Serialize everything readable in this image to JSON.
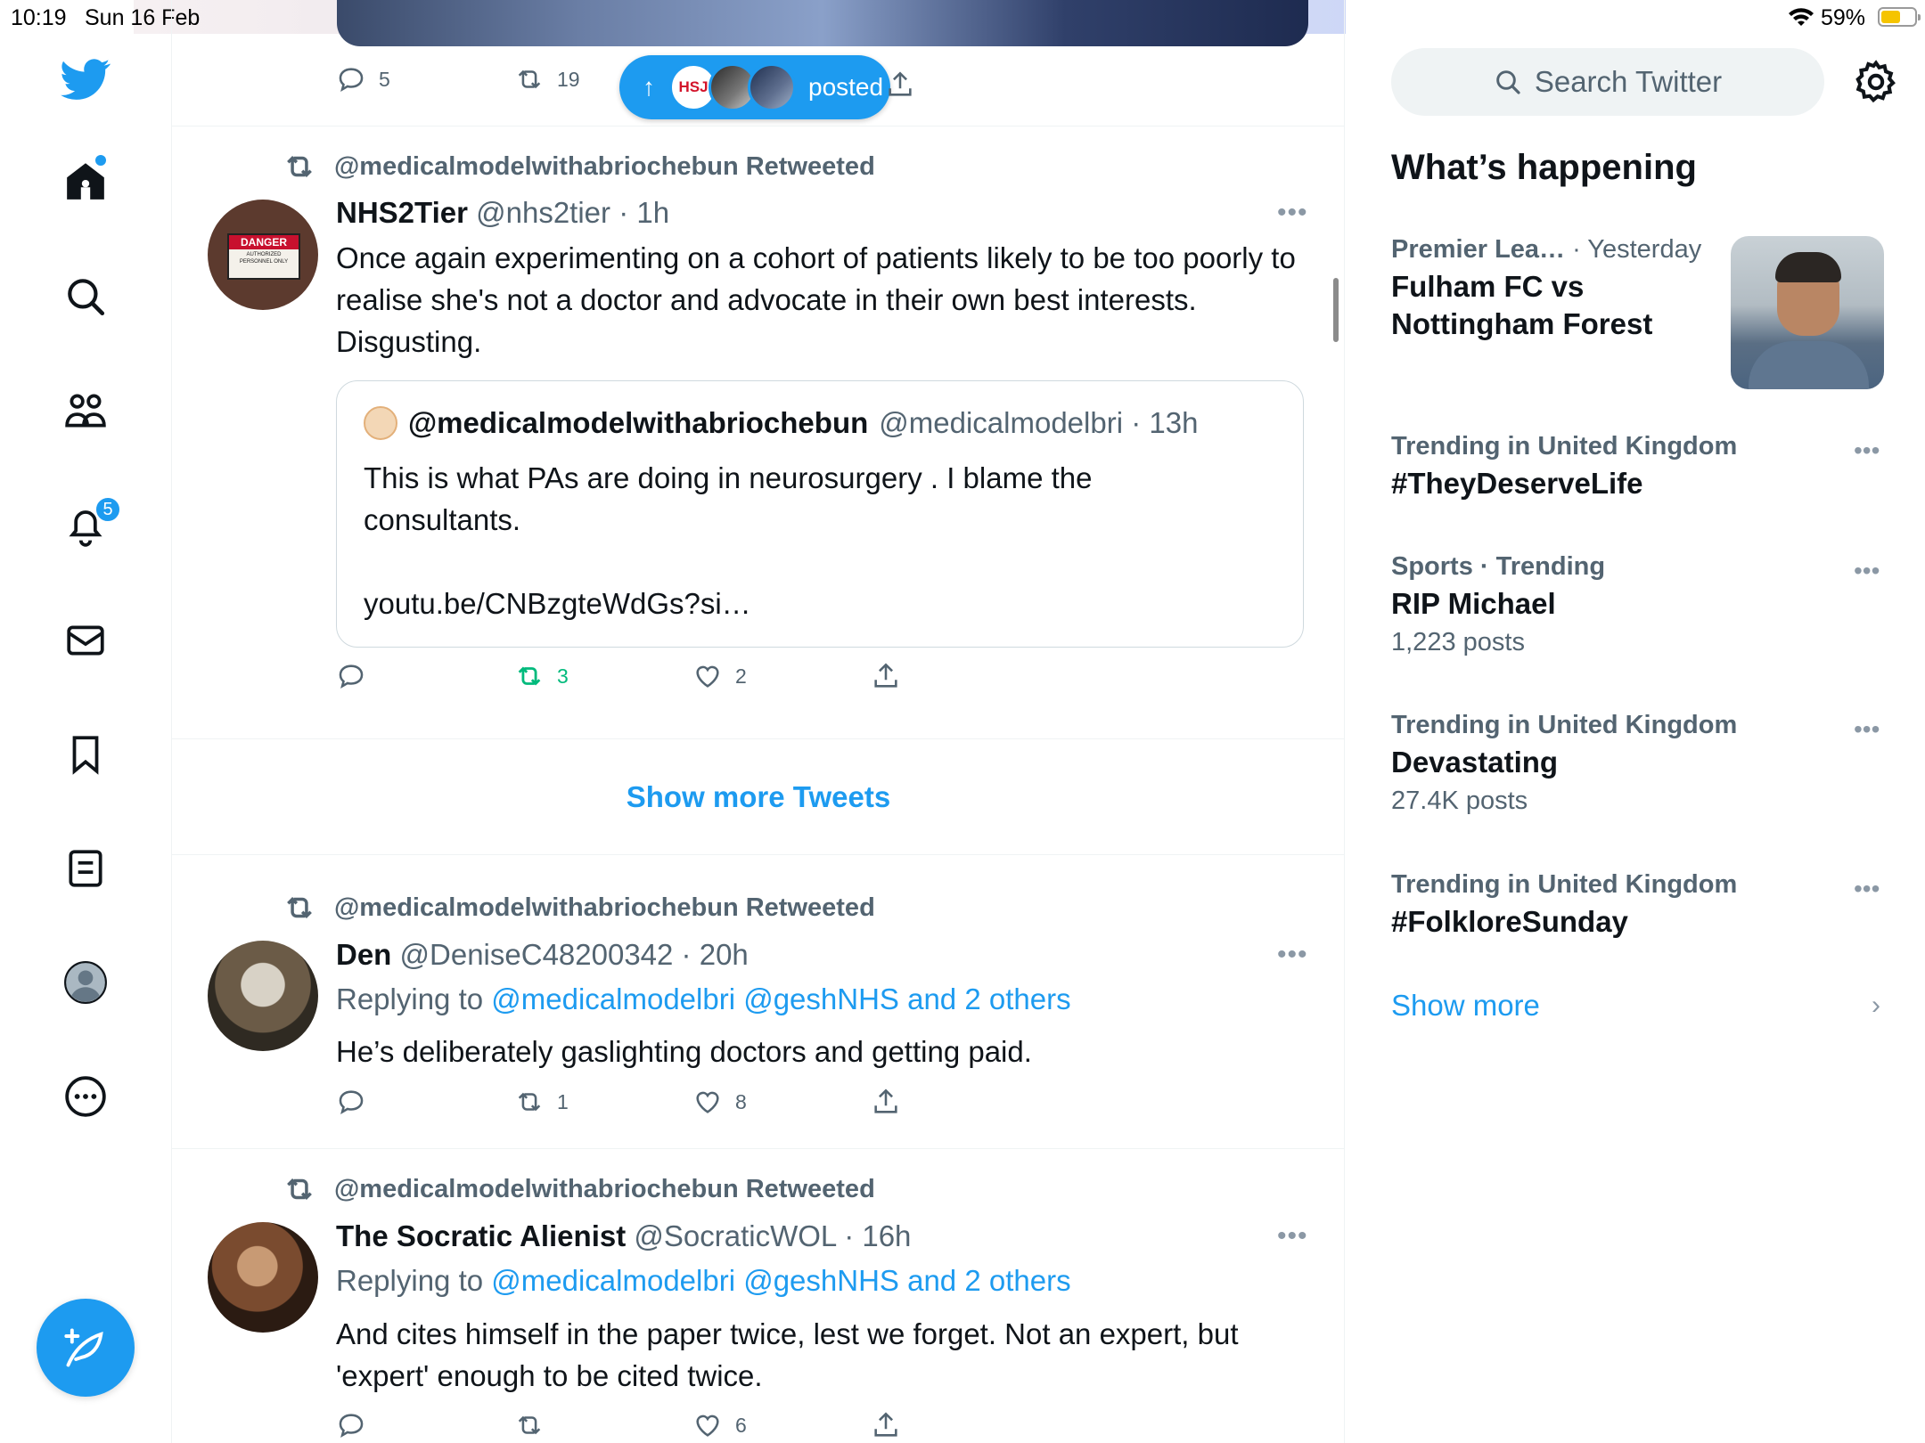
{
  "status_bar": {
    "time": "10:19",
    "date": "Sun 16 Feb",
    "battery": "59%",
    "battery_level": 0.59
  },
  "nav": {
    "items": [
      "twitter-logo",
      "home",
      "explore",
      "communities",
      "notifications",
      "messages",
      "bookmarks",
      "lists",
      "profile",
      "more"
    ],
    "notifications_badge": "5"
  },
  "top_tweet_actions": {
    "replies": "5",
    "retweets": "19"
  },
  "new_posts_pill": {
    "arrow": "↑",
    "label": "posted",
    "avatar_logo_text": "HSJ"
  },
  "tweets": [
    {
      "retweeted_by": "@medicalmodelwithabriochebun Retweeted",
      "name": "NHS2Tier",
      "handle_time": "@nhs2tier · 1h",
      "text": "Once again experimenting on a cohort of patients likely to be too poorly to realise she's not a doctor and advocate in their own best interests. Disgusting.",
      "quote": {
        "name": "@medicalmodelwithabriochebun",
        "handle_time": "@medicalmodelbri · 13h",
        "text_line1": "This is what PAs are doing in neurosurgery . I blame the consultants.",
        "link": "youtu.be/CNBzgteWdGs?si…"
      },
      "replies": "",
      "retweets": "3",
      "likes": "2"
    },
    {
      "retweeted_by": "@medicalmodelwithabriochebun Retweeted",
      "name": "Den",
      "handle_time": "@DeniseC48200342 · 20h",
      "replying_prefix": "Replying to ",
      "replying_to": "@medicalmodelbri @geshNHS and 2 others",
      "text": "He’s deliberately gaslighting doctors and getting paid.",
      "replies": "",
      "retweets": "1",
      "likes": "8"
    },
    {
      "retweeted_by": "@medicalmodelwithabriochebun Retweeted",
      "name": "The Socratic Alienist",
      "handle_time": "@SocraticWOL · 16h",
      "replying_prefix": "Replying to ",
      "replying_to": "@medicalmodelbri @geshNHS and 2 others",
      "text": "And cites himself in the paper twice, lest we forget. Not an expert, but 'expert' enough to be cited twice.",
      "replies": "",
      "retweets": "",
      "likes": "6"
    }
  ],
  "show_more_tweets": "Show more Tweets",
  "sidebar": {
    "search_placeholder": "Search Twitter",
    "heading": "What’s happening",
    "featured": {
      "category": "Premier Lea…",
      "time": "· Yesterday",
      "title": "Fulham FC vs Nottingham Forest"
    },
    "trends": [
      {
        "meta": "Trending in United Kingdom",
        "title": "#TheyDeserveLife",
        "count": ""
      },
      {
        "meta": "Sports · Trending",
        "title": "RIP Michael",
        "count": "1,223 posts"
      },
      {
        "meta": "Trending in United Kingdom",
        "title": "Devastating",
        "count": "27.4K posts"
      },
      {
        "meta": "Trending in United Kingdom",
        "title": "#FolkloreSunday",
        "count": ""
      }
    ],
    "show_more": "Show more"
  },
  "colors": {
    "accent": "#1d9bf0",
    "retweet_green": "#00ba7c",
    "muted": "#536471"
  }
}
